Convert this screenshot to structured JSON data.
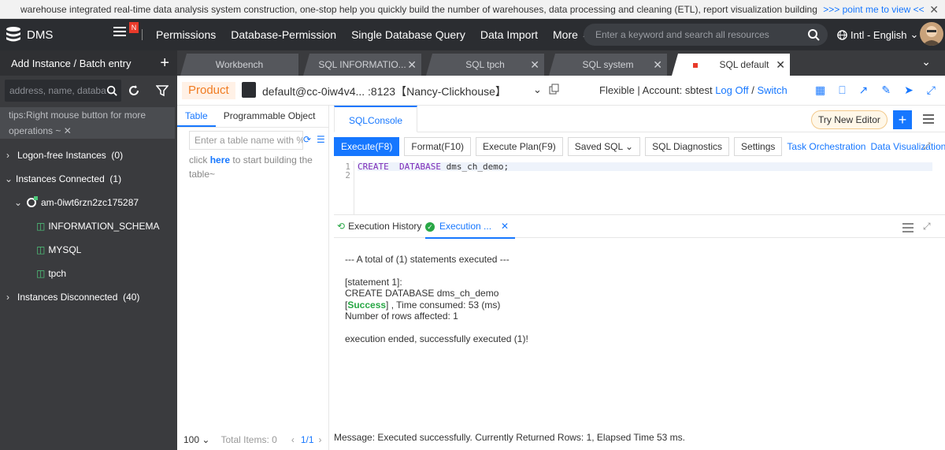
{
  "banner": {
    "text": "warehouse integrated real-time data analysis system construction, one-stop help you quickly build the number of warehouses, data processing and cleaning (ETL), report visualization building",
    "link": ">>> point me to view <<",
    "close": "✕"
  },
  "topnav": {
    "logo": "DMS",
    "badge": "N",
    "items": [
      "Permissions",
      "Database-Permission",
      "Single Database Query",
      "Data Import",
      "More"
    ],
    "search_placeholder": "Enter a keyword and search all resources",
    "language": "Intl - English"
  },
  "sidebar": {
    "header": "Add Instance / Batch entry",
    "search_placeholder": "address, name, databa",
    "tips": "tips:Right mouse button for more operations ~",
    "tree": {
      "logon_free": "Logon-free Instances",
      "logon_free_count": "(0)",
      "connected": "Instances Connected",
      "connected_count": "(1)",
      "instance": "am-0iwt6rzn2zc175287",
      "databases": [
        "INFORMATION_SCHEMA",
        "MYSQL",
        "tpch"
      ],
      "disconnected": "Instances Disconnected",
      "disconnected_count": "(40)"
    }
  },
  "tabs": [
    {
      "label": "Workbench",
      "closable": false
    },
    {
      "label": "SQL INFORMATIO...",
      "closable": true
    },
    {
      "label": "SQL tpch",
      "closable": true
    },
    {
      "label": "SQL system",
      "closable": true
    },
    {
      "label": "SQL default",
      "closable": true,
      "active": true
    }
  ],
  "connection": {
    "env": "Product",
    "name": "default@cc-0iw4v4... :8123【Nancy-Clickhouse】",
    "mode": "Flexible | Account: sbtest",
    "logoff": "Log Off",
    "separator": "/",
    "switch": "Switch"
  },
  "object_panel": {
    "tabs": [
      "Table",
      "Programmable Object"
    ],
    "filter_placeholder": "Enter a table name with %",
    "hint_prefix": "click",
    "hint_link": "here",
    "hint_suffix": "to start building the table~",
    "page_size": "100",
    "total": "Total Items: 0",
    "page": "1/1"
  },
  "editor": {
    "tab": "SQLConsole",
    "try_new": "Try New Editor",
    "toolbar": {
      "execute": "Execute(F8)",
      "format": "Format(F10)",
      "plan": "Execute Plan(F9)",
      "saved": "Saved SQL",
      "diagnostics": "SQL Diagnostics",
      "settings": "Settings",
      "orchestration": "Task Orchestration",
      "visualization": "Data Visualization"
    },
    "lines": [
      "1",
      "2"
    ],
    "code_kw1": "CREATE",
    "code_kw2": "DATABASE",
    "code_rest": "dms_ch_demo;"
  },
  "results": {
    "history_tab": "Execution History",
    "exec_tab": "Execution ...",
    "summary": "--- A total of (1) statements executed ---",
    "statement": "[statement 1]:",
    "sql": "CREATE DATABASE dms_ch_demo",
    "bracket_open": "[",
    "success": "Success",
    "time": "] , Time consumed: 53 (ms)",
    "rows": "Number of rows affected: 1",
    "ended": "execution ended, successfully executed (1)!"
  },
  "status": "Message: Executed successfully. Currently Returned Rows: 1, Elapsed Time 53 ms.",
  "colors": {
    "accent": "#1677ff",
    "success": "#28a745",
    "product": "#f07c22"
  }
}
